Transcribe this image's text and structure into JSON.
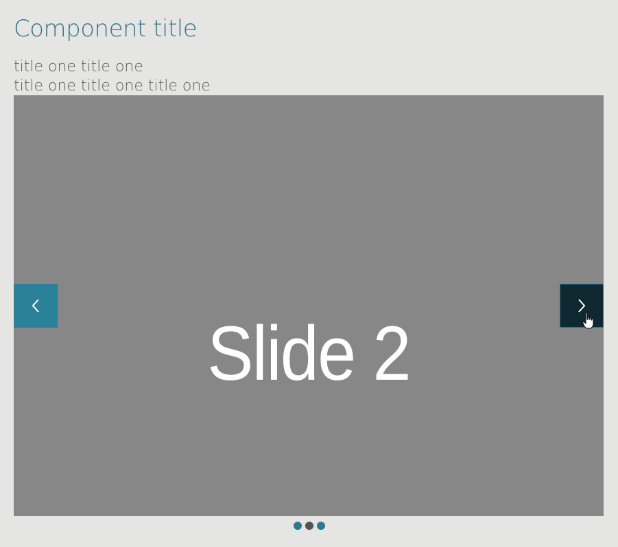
{
  "component": {
    "title": "Component title",
    "subtitle_lines": [
      "title one title one",
      "title one title one title one"
    ]
  },
  "carousel": {
    "slide_label": "Slide 2",
    "active_index": 2,
    "total_slides": 3,
    "prev_icon": "chevron-left-icon",
    "next_icon": "chevron-right-icon",
    "dots": [
      {
        "active": false
      },
      {
        "active": true
      },
      {
        "active": false
      }
    ]
  },
  "colors": {
    "background": "#e5e5e3",
    "title": "#3b7487",
    "slide_background": "#878787",
    "prev_button": "#2b8197",
    "next_button_hover": "#10282f",
    "dot": "#2b7b8e",
    "dot_active": "#4f5455"
  }
}
